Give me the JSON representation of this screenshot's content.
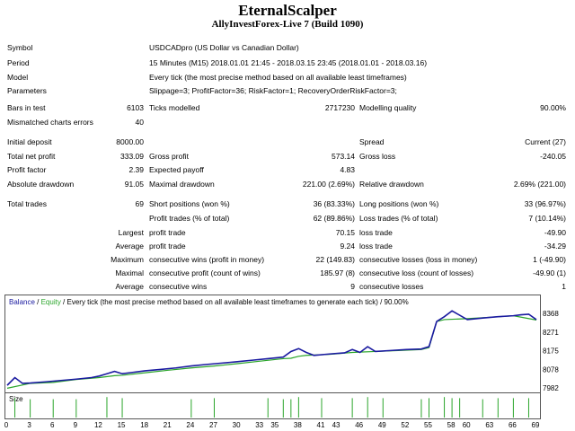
{
  "header": {
    "title": "EternalScalper",
    "subtitle": "AllyInvestForex-Live 7 (Build 1090)"
  },
  "report": {
    "symbol_label": "Symbol",
    "symbol_value": "USDCADpro (US Dollar vs Canadian Dollar)",
    "period_label": "Period",
    "period_value": "15 Minutes (M15) 2018.01.01 21:45 - 2018.03.15 23:45 (2018.01.01 - 2018.03.16)",
    "model_label": "Model",
    "model_value": "Every tick (the most precise method based on all available least timeframes)",
    "params_label": "Parameters",
    "params_value": "Slippage=3; ProfitFactor=36; RiskFactor=1; RecoveryOrderRiskFactor=3;",
    "bars_label": "Bars in test",
    "bars_value": "6103",
    "ticks_label": "Ticks modelled",
    "ticks_value": "2717230",
    "quality_label": "Modelling quality",
    "quality_value": "90.00%",
    "mismatch_label": "Mismatched charts errors",
    "mismatch_value": "40",
    "deposit_label": "Initial deposit",
    "deposit_value": "8000.00",
    "spread_label": "Spread",
    "spread_value": "Current (27)",
    "netprofit_label": "Total net profit",
    "netprofit_value": "333.09",
    "grossprofit_label": "Gross profit",
    "grossprofit_value": "573.14",
    "grossloss_label": "Gross loss",
    "grossloss_value": "-240.05",
    "pf_label": "Profit factor",
    "pf_value": "2.39",
    "payoff_label": "Expected payoff",
    "payoff_value": "4.83",
    "absdd_label": "Absolute drawdown",
    "absdd_value": "91.05",
    "maxdd_label": "Maximal drawdown",
    "maxdd_value": "221.00 (2.69%)",
    "reldd_label": "Relative drawdown",
    "reldd_value": "2.69% (221.00)",
    "trades_label": "Total trades",
    "trades_value": "69",
    "short_label": "Short positions (won %)",
    "short_value": "36 (83.33%)",
    "long_label": "Long positions (won %)",
    "long_value": "33 (96.97%)",
    "ptrades_label": "Profit trades (% of total)",
    "ptrades_value": "62 (89.86%)",
    "ltrades_label": "Loss trades (% of total)",
    "ltrades_value": "7 (10.14%)",
    "largest_label": "Largest",
    "largest_pt_label": "profit trade",
    "largest_pt_value": "70.15",
    "largest_lt_label": "loss trade",
    "largest_lt_value": "-49.90",
    "average_label": "Average",
    "average_pt_label": "profit trade",
    "average_pt_value": "9.24",
    "average_lt_label": "loss trade",
    "average_lt_value": "-34.29",
    "maximum_label": "Maximum",
    "max_cw_label": "consecutive wins (profit in money)",
    "max_cw_value": "22 (149.83)",
    "max_cl_label": "consecutive losses (loss in money)",
    "max_cl_value": "1 (-49.90)",
    "maximal_label": "Maximal",
    "maxl_cp_label": "consecutive profit (count of wins)",
    "maxl_cp_value": "185.97 (8)",
    "maxl_cl_label": "consecutive loss (count of losses)",
    "maxl_cl_value": "-49.90 (1)",
    "avg2_label": "Average",
    "avg_cw_label": "consecutive wins",
    "avg_cw_value": "9",
    "avg_cl_label": "consecutive losses",
    "avg_cl_value": "1"
  },
  "chart_legend": {
    "balance": "Balance",
    "sep1": " / ",
    "equity": "Equity",
    "rest": " / Every tick (the most precise method based on all available least timeframes to generate each tick) / 90.00%",
    "balance_color": "#1a1aa0",
    "equity_color": "#2aa52a"
  },
  "size_label": "Size",
  "chart_data": {
    "type": "line",
    "ylabels": [
      "8368",
      "8271",
      "8175",
      "8078",
      "7982"
    ],
    "ylim": [
      7982,
      8400
    ],
    "xticks": [
      "0",
      "3",
      "6",
      "9",
      "12",
      "15",
      "18",
      "21",
      "24",
      "27",
      "30",
      "33",
      "35",
      "38",
      "41",
      "43",
      "46",
      "49",
      "52",
      "55",
      "58",
      "60",
      "63",
      "66",
      "69"
    ],
    "xlim": [
      0,
      69
    ],
    "series": [
      {
        "name": "Balance",
        "color": "#1a1aa0",
        "x": [
          0,
          1,
          2,
          3,
          5,
          7,
          9,
          11,
          12,
          13,
          14,
          15,
          16,
          18,
          20,
          22,
          24,
          26,
          28,
          30,
          32,
          34,
          36,
          37,
          38,
          39,
          40,
          42,
          44,
          45,
          46,
          47,
          48,
          50,
          52,
          54,
          55,
          56,
          57,
          58,
          60,
          62,
          64,
          66,
          67,
          68,
          69
        ],
        "y": [
          8000,
          8040,
          8010,
          8012,
          8018,
          8025,
          8032,
          8040,
          8048,
          8060,
          8072,
          8060,
          8065,
          8075,
          8082,
          8090,
          8100,
          8108,
          8115,
          8122,
          8130,
          8138,
          8146,
          8175,
          8190,
          8170,
          8155,
          8162,
          8168,
          8185,
          8170,
          8200,
          8175,
          8180,
          8185,
          8188,
          8200,
          8330,
          8355,
          8385,
          8340,
          8348,
          8355,
          8360,
          8365,
          8368,
          8340
        ]
      },
      {
        "name": "Equity",
        "color": "#2aa52a",
        "x": [
          0,
          3,
          6,
          9,
          12,
          14,
          15,
          18,
          21,
          24,
          27,
          30,
          33,
          36,
          37,
          38,
          39,
          42,
          45,
          46,
          48,
          51,
          54,
          55,
          56,
          57,
          60,
          63,
          66,
          69
        ],
        "y": [
          7985,
          8010,
          8015,
          8030,
          8040,
          8050,
          8052,
          8065,
          8078,
          8090,
          8100,
          8112,
          8125,
          8138,
          8140,
          8150,
          8155,
          8160,
          8170,
          8172,
          8175,
          8180,
          8185,
          8195,
          8330,
          8340,
          8345,
          8352,
          8360,
          8338
        ]
      }
    ],
    "size_bars": {
      "x": [
        1,
        3,
        6,
        9,
        13,
        15,
        24,
        27,
        34,
        36,
        37,
        38,
        41,
        45,
        47,
        49,
        54,
        55,
        57,
        58,
        59,
        62,
        64,
        66,
        68
      ],
      "h": [
        0.9,
        0.85,
        0.85,
        0.85,
        0.95,
        0.9,
        0.85,
        0.9,
        0.9,
        0.85,
        0.85,
        0.95,
        0.9,
        0.9,
        0.95,
        0.9,
        0.85,
        0.9,
        0.95,
        0.9,
        0.9,
        0.85,
        0.9,
        0.9,
        0.9
      ]
    }
  }
}
